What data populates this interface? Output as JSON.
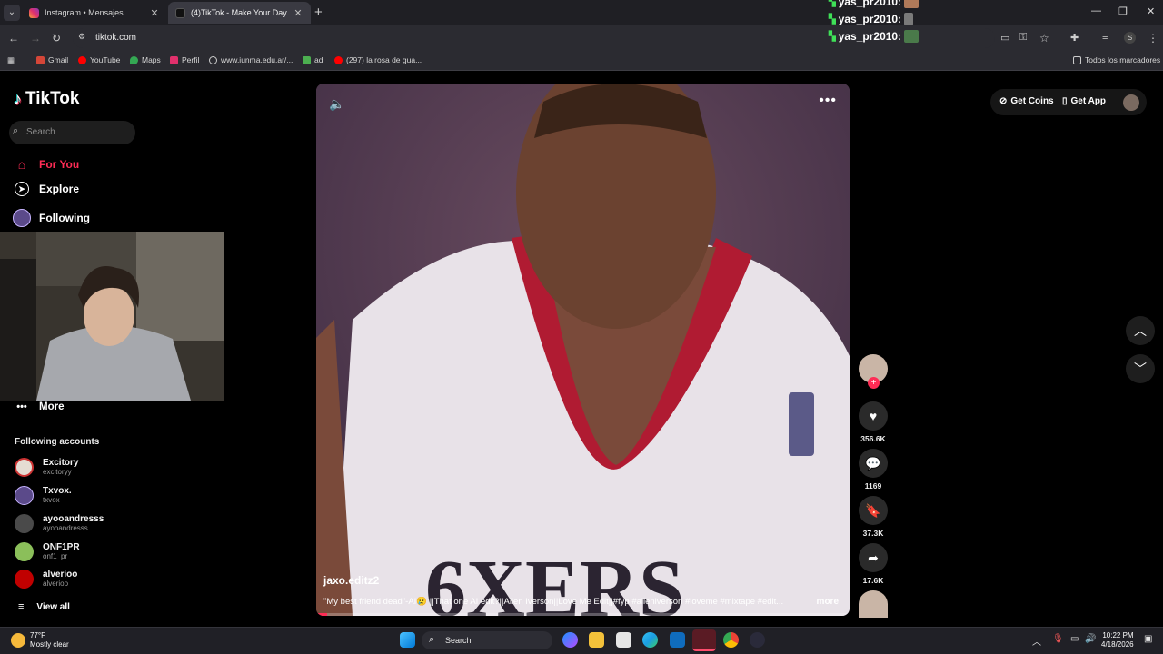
{
  "browser": {
    "tabs": [
      {
        "title": "Instagram • Mensajes",
        "active": false
      },
      {
        "title": "(4)TikTok - Make Your Day",
        "active": true
      }
    ],
    "url": "tiktok.com",
    "bookmarks": [
      "Gmail",
      "YouTube",
      "Maps",
      "Perfil",
      "www.iunma.edu.ar/...",
      "ad",
      "(297) la rosa de gua..."
    ],
    "all_bookmarks": "Todos los marcadores"
  },
  "chat": [
    "yas_pr2010:",
    "yas_pr2010:",
    "yas_pr2010:"
  ],
  "tiktok": {
    "brand": "TikTok",
    "search_placeholder": "Search",
    "nav": {
      "for_you": "For You",
      "explore": "Explore",
      "following": "Following",
      "more": "More"
    },
    "following_accounts_title": "Following accounts",
    "accounts": [
      {
        "name": "Excitory",
        "handle": "excitoryy"
      },
      {
        "name": "Txvox.",
        "handle": "txvox"
      },
      {
        "name": "ayooandresss",
        "handle": "ayooandresss"
      },
      {
        "name": "ONF1PR",
        "handle": "onf1_pr"
      },
      {
        "name": "alverioo",
        "handle": "alverioo"
      }
    ],
    "view_all": "View all",
    "get_coins": "Get Coins",
    "get_app": "Get App",
    "video": {
      "author": "jaxo.editz2",
      "description": "\"My best friend dead\"-AI😢 ||That one AI edit?||Allen Iverson||Love Me Edit||#fyp #alleniverson #loveme #mixtape #edit...",
      "more": "more",
      "progress": 0.02
    },
    "actions": {
      "likes": "356.6K",
      "comments": "1169",
      "saves": "37.3K",
      "shares": "17.6K"
    }
  },
  "taskbar": {
    "temp": "77°F",
    "weather": "Mostly clear",
    "search": "Search",
    "time": "10:22 PM",
    "date": "4/18/2026"
  }
}
